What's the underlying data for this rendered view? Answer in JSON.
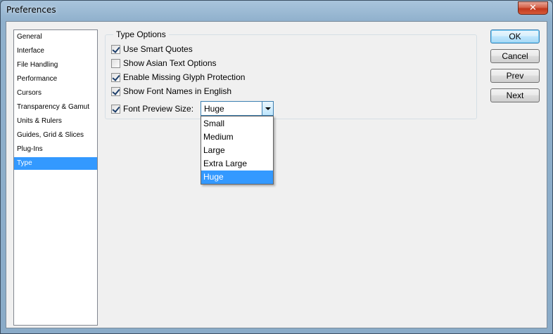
{
  "window": {
    "title": "Preferences",
    "close_glyph": "✕"
  },
  "sidebar": {
    "items": [
      {
        "label": "General"
      },
      {
        "label": "Interface"
      },
      {
        "label": "File Handling"
      },
      {
        "label": "Performance"
      },
      {
        "label": "Cursors"
      },
      {
        "label": "Transparency & Gamut"
      },
      {
        "label": "Units & Rulers"
      },
      {
        "label": "Guides, Grid & Slices"
      },
      {
        "label": "Plug-Ins"
      },
      {
        "label": "Type",
        "selected": true
      }
    ]
  },
  "type_options": {
    "group_title": "Type Options",
    "checkboxes": [
      {
        "label": "Use Smart Quotes",
        "checked": true
      },
      {
        "label": "Show Asian Text Options",
        "checked": false
      },
      {
        "label": "Enable Missing Glyph Protection",
        "checked": true
      },
      {
        "label": "Show Font Names in English",
        "checked": true
      },
      {
        "label": "Font Preview Size:",
        "checked": true
      }
    ],
    "preview_size": {
      "selected": "Huge",
      "options": [
        "Small",
        "Medium",
        "Large",
        "Extra Large",
        "Huge"
      ]
    }
  },
  "buttons": {
    "ok": "OK",
    "cancel": "Cancel",
    "prev": "Prev",
    "next": "Next"
  },
  "colors": {
    "selection": "#3399ff",
    "accent_border": "#3c7fb1",
    "close": "#c2381d"
  }
}
